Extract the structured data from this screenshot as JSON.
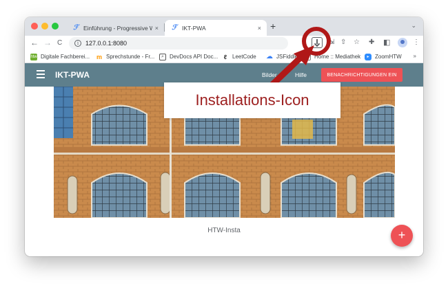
{
  "browser": {
    "tabs": [
      {
        "label": "Einführung - Progressive Web",
        "close": "×",
        "favicon": "ℱ",
        "active": false
      },
      {
        "label": "IKT-PWA",
        "close": "×",
        "favicon": "ℱ",
        "active": true
      }
    ],
    "new_tab": "+",
    "tab_menu": "⌄",
    "url": "127.0.0.1:8080",
    "nav": {
      "back": "←",
      "forward": "→",
      "reload": "C"
    }
  },
  "bookmarks": [
    {
      "label": "Digitale Fachberei...",
      "icon": "htw",
      "color": "#6fae2f"
    },
    {
      "label": "Sprechstunde - Fr...",
      "icon": "m",
      "color": "#ff9800"
    },
    {
      "label": "DevDocs API Doc...",
      "icon": "search",
      "color": "#555555"
    },
    {
      "label": "LeetCode",
      "icon": "leetcode",
      "color": "#333333"
    },
    {
      "label": "JSFiddle",
      "icon": "cloud",
      "color": "#3b82f6"
    },
    {
      "label": "Home :: Mediathek",
      "icon": "page",
      "color": "#7a7a7a"
    },
    {
      "label": "ZoomHTW",
      "icon": "zoom",
      "color": "#2d8cff"
    }
  ],
  "bookmarks_more": "»",
  "app": {
    "title": "IKT-PWA",
    "nav_links": [
      "Bilder",
      "Hilfe"
    ],
    "notify_button": "BENACHRICHTIGUNGEN EIN",
    "caption": "HTW-Insta",
    "fab_label": "+"
  },
  "annotation": {
    "label": "Installations-Icon",
    "color": "#b01818"
  },
  "colors": {
    "appbar": "#5e7f8c",
    "accent": "#ee5256"
  }
}
